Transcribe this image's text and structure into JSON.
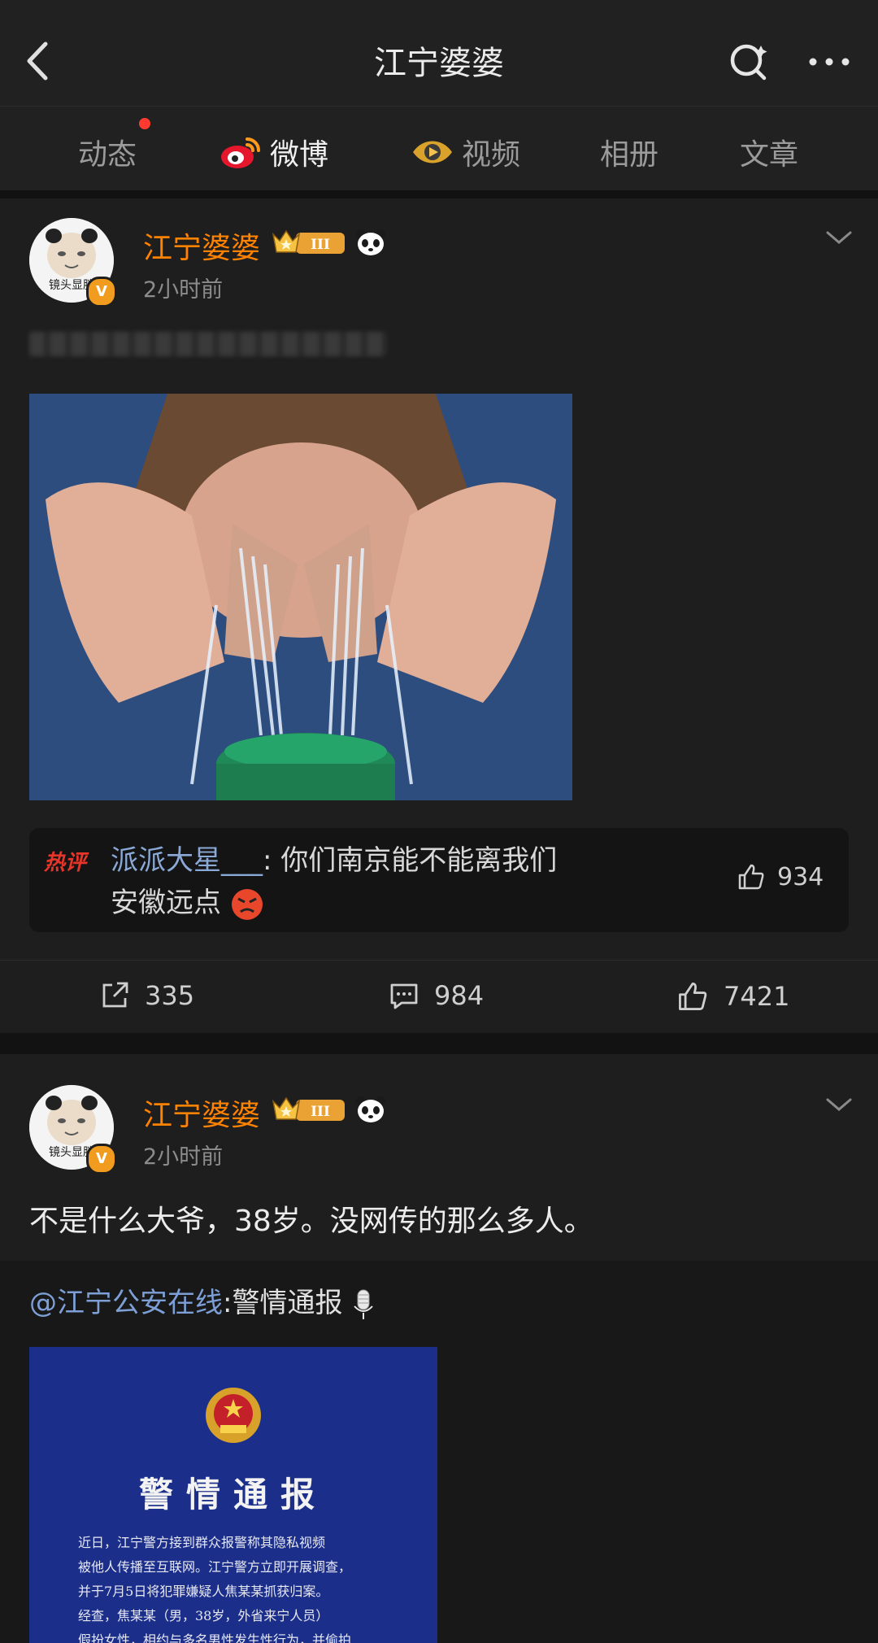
{
  "header": {
    "title": "江宁婆婆"
  },
  "tabs": [
    {
      "label": "动态"
    },
    {
      "label": "微博"
    },
    {
      "label": "视频"
    },
    {
      "label": "相册"
    },
    {
      "label": "文章"
    }
  ],
  "posts": [
    {
      "author": "江宁婆婆",
      "avatar_caption": "镜头显胖",
      "verified_mark": "V",
      "level_badge": "III",
      "time": "2小时前",
      "hot_label": "热评",
      "hot_comment": {
        "user": "派派大星___",
        "text": ": 你们南京能不能离我们安徽远点",
        "likes": "934"
      },
      "stats": {
        "reposts": "335",
        "comments": "984",
        "likes": "7421"
      }
    },
    {
      "author": "江宁婆婆",
      "avatar_caption": "镜头显胖",
      "verified_mark": "V",
      "level_badge": "III",
      "time": "2小时前",
      "text": "不是什么大爷，38岁。没网传的那么多人。",
      "repost": {
        "mention": "@江宁公安在线",
        "text": ":警情通报",
        "image_title": "警情通报",
        "image_lines": [
          "近日，江宁警方接到群众报警称其隐私视频",
          "被他人传播至互联网。江宁警方立即开展调查，",
          "并于7月5日将犯罪嫌疑人焦某某抓获归案。",
          "经查，焦某某（男，38岁，外省来宁人员）",
          "假扮女性，相约与多名男性发生性行为，并偷拍"
        ]
      }
    }
  ]
}
